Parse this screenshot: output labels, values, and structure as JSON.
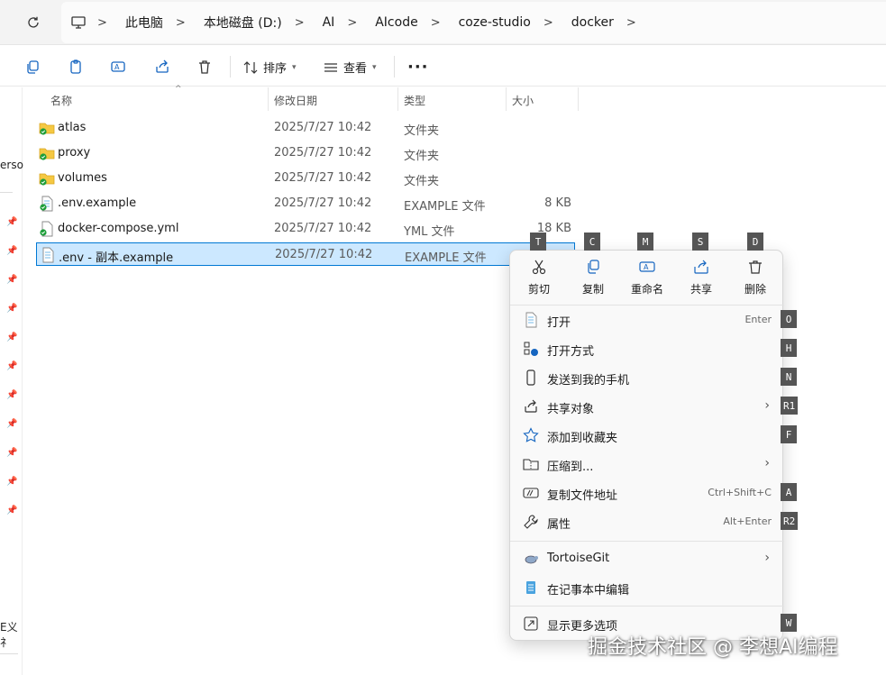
{
  "breadcrumb": [
    "此电脑",
    "本地磁盘 (D:)",
    "AI",
    "AIcode",
    "coze-studio",
    "docker"
  ],
  "toolbar": {
    "sort_label": "排序",
    "view_label": "查看",
    "more_label": "···"
  },
  "left_pane": {
    "partial_text_1": "erso",
    "partial_text_2": "E义礻"
  },
  "columns": {
    "name": "名称",
    "date": "修改日期",
    "type": "类型",
    "size": "大小"
  },
  "files": [
    {
      "name": "atlas",
      "date": "2025/7/27 10:42",
      "type": "文件夹",
      "size": "",
      "icon": "folder-icon"
    },
    {
      "name": "proxy",
      "date": "2025/7/27 10:42",
      "type": "文件夹",
      "size": "",
      "icon": "folder-icon"
    },
    {
      "name": "volumes",
      "date": "2025/7/27 10:42",
      "type": "文件夹",
      "size": "",
      "icon": "folder-icon"
    },
    {
      "name": ".env.example",
      "date": "2025/7/27 10:42",
      "type": "EXAMPLE 文件",
      "size": "8 KB",
      "icon": "file-icon"
    },
    {
      "name": "docker-compose.yml",
      "date": "2025/7/27 10:42",
      "type": "YML 文件",
      "size": "18 KB",
      "icon": "file-icon"
    },
    {
      "name": ".env - 副本.example",
      "date": "2025/7/27 10:42",
      "type": "EXAMPLE 文件",
      "size": "",
      "icon": "file-icon",
      "selected": true
    }
  ],
  "context_menu": {
    "quick_actions": [
      {
        "label": "剪切",
        "key": "T",
        "icon": "scissors-icon"
      },
      {
        "label": "复制",
        "key": "C",
        "icon": "copy-icon"
      },
      {
        "label": "重命名",
        "key": "M",
        "icon": "rename-icon"
      },
      {
        "label": "共享",
        "key": "S",
        "icon": "share-icon"
      },
      {
        "label": "删除",
        "key": "D",
        "icon": "trash-icon"
      }
    ],
    "items": [
      {
        "label": "打开",
        "shortcut": "Enter",
        "key": "O",
        "icon": "notepad-icon"
      },
      {
        "label": "打开方式",
        "shortcut": "",
        "key": "H",
        "icon": "open-with-icon"
      },
      {
        "label": "发送到我的手机",
        "shortcut": "",
        "key": "N",
        "icon": "phone-icon"
      },
      {
        "label": "共享对象",
        "shortcut": "",
        "key": "R1",
        "icon": "share-icon",
        "submenu": true
      },
      {
        "label": "添加到收藏夹",
        "shortcut": "",
        "key": "F",
        "icon": "star-icon"
      },
      {
        "label": "压缩到...",
        "shortcut": "",
        "key": "",
        "icon": "zip-icon",
        "submenu": true
      },
      {
        "label": "复制文件地址",
        "shortcut": "Ctrl+Shift+C",
        "key": "A",
        "icon": "path-icon"
      },
      {
        "label": "属性",
        "shortcut": "Alt+Enter",
        "key": "R2",
        "icon": "wrench-icon"
      },
      {
        "label": "TortoiseGit",
        "shortcut": "",
        "key": "",
        "icon": "tortoise-icon",
        "submenu": true
      },
      {
        "label": "在记事本中编辑",
        "shortcut": "",
        "key": "",
        "icon": "notepad-edit-icon"
      },
      {
        "label": "显示更多选项",
        "shortcut": "",
        "key": "W",
        "icon": "more-options-icon"
      }
    ]
  },
  "watermark": "掘金技术社区 @ 李想AI编程",
  "colors": {
    "selection_bg": "#cce8ff",
    "selection_border": "#0078d4",
    "accent": "#1565c0",
    "key_badge": "#555555"
  }
}
